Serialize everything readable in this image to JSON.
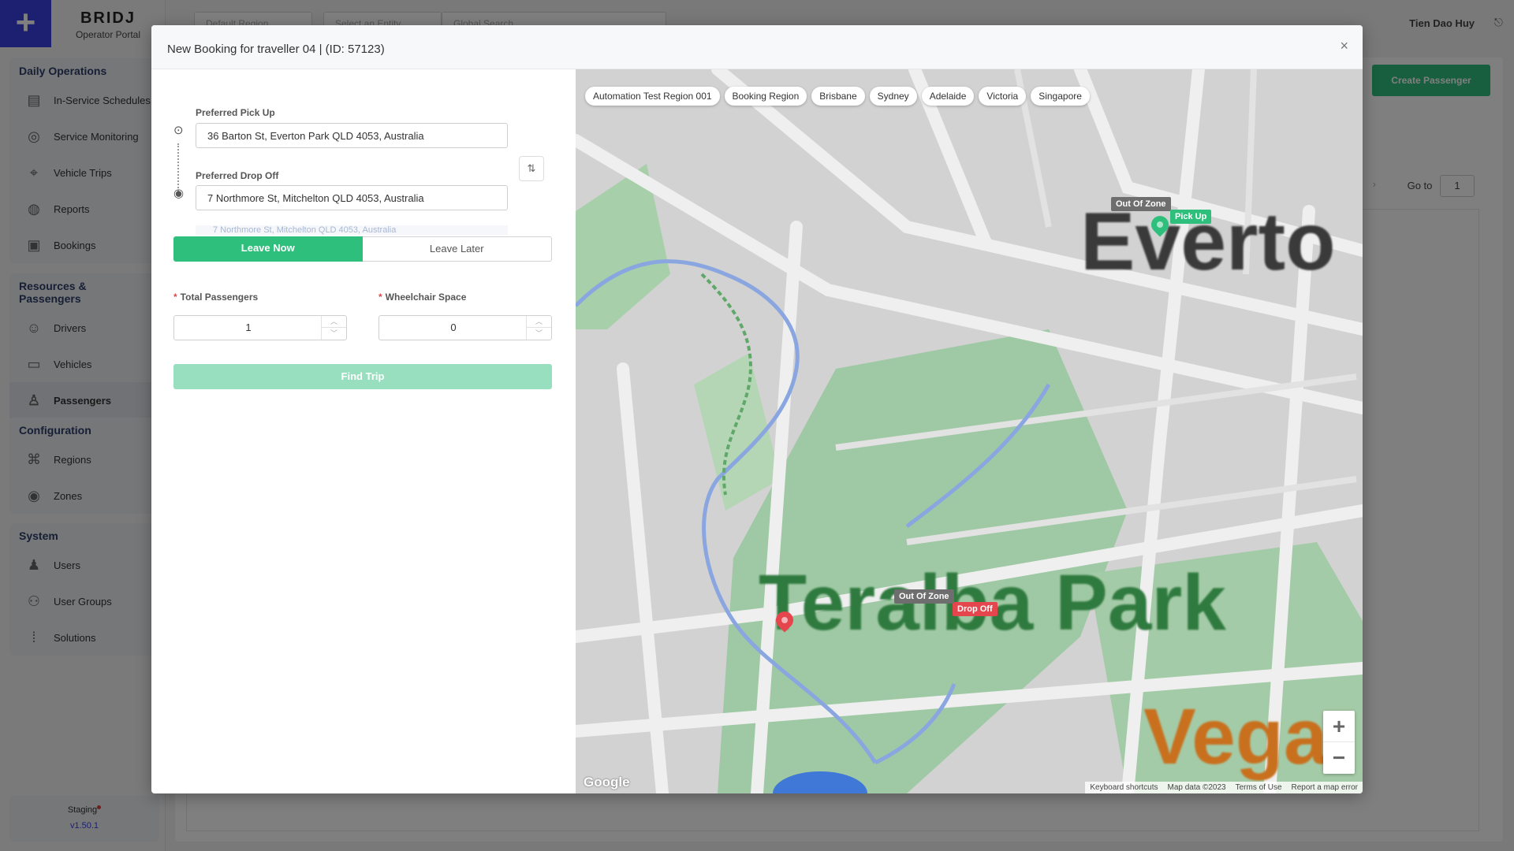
{
  "app": {
    "logo_glyph": "+",
    "brand_name": "BRIDJ",
    "brand_sub": "Operator Portal",
    "top_selects": [
      "Default Region",
      "Select an Entity",
      "Global Search"
    ],
    "user_name": "Tien Dao Huy",
    "create_button": "Create Passenger",
    "goto_label": "Go to",
    "goto_value": "1",
    "env_name": "Staging",
    "env_version": "v1.50.1"
  },
  "sidebar": {
    "sections": [
      {
        "title": "Daily Operations",
        "items": [
          "In-Service Schedules",
          "Service Monitoring",
          "Vehicle Trips",
          "Reports",
          "Bookings"
        ]
      },
      {
        "title": "Resources & Passengers",
        "items": [
          "Drivers",
          "Vehicles",
          "Passengers"
        ]
      },
      {
        "title": "Configuration",
        "items": [
          "Regions",
          "Zones"
        ]
      },
      {
        "title": "System",
        "items": [
          "Users",
          "User Groups",
          "Solutions"
        ]
      }
    ],
    "active_item": "Passengers"
  },
  "modal": {
    "title": "New Booking for traveller 04 | (ID: 57123)",
    "close_glyph": "×",
    "pickup_label": "Preferred Pick Up",
    "pickup_value": "36 Barton St, Everton Park QLD 4053, Australia",
    "dropoff_label": "Preferred Drop Off",
    "dropoff_value": "7 Northmore St, Mitchelton QLD 4053, Australia",
    "suggestion_ghost": "7 Northmore St, Mitchelton QLD 4053, Australia",
    "leave_now": "Leave Now",
    "leave_later": "Leave Later",
    "passengers_label": "Total Passengers",
    "passengers_value": "1",
    "wheelchair_label": "Wheelchair Space",
    "wheelchair_value": "0",
    "find_trip": "Find Trip"
  },
  "map": {
    "regions": [
      "Automation Test Region 001",
      "Booking Region",
      "Brisbane",
      "Sydney",
      "Adelaide",
      "Victoria",
      "Singapore"
    ],
    "place_labels": [
      "Everto",
      "Teralba Park",
      "Vega"
    ],
    "pickup_zone_tag": "Out Of Zone",
    "pickup_tag": "Pick Up",
    "dropoff_zone_tag": "Out Of Zone",
    "dropoff_tag": "Drop Off",
    "google": "Google",
    "attribution": [
      "Keyboard shortcuts",
      "Map data ©2023",
      "Terms of Use",
      "Report a map error"
    ]
  },
  "colors": {
    "accent_green": "#2fbf7c",
    "drop_red": "#e5454d",
    "brand_blue": "#3a3fe0"
  }
}
